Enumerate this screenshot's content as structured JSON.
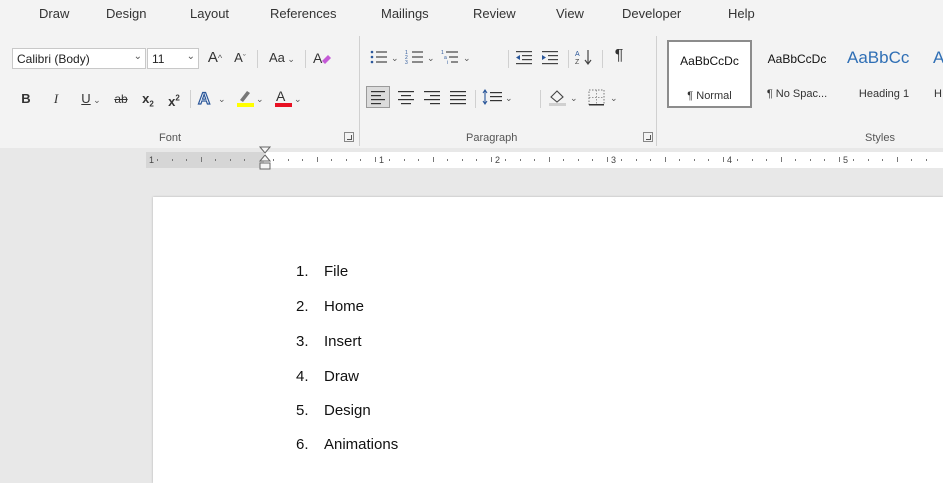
{
  "menu": {
    "items": [
      "Draw",
      "Design",
      "Layout",
      "References",
      "Mailings",
      "Review",
      "View",
      "Developer",
      "Help"
    ]
  },
  "font_group": {
    "font_name": "Calibri (Body)",
    "font_size": "11",
    "change_case_label": "Aa",
    "label": "Font"
  },
  "paragraph_group": {
    "label": "Paragraph"
  },
  "styles_group": {
    "label": "Styles",
    "items": [
      {
        "preview": "AaBbCcDc",
        "name": "¶ Normal"
      },
      {
        "preview": "AaBbCcDc",
        "name": "¶ No Spac..."
      },
      {
        "preview": "AaBbCc",
        "name": "Heading 1"
      },
      {
        "preview": "A",
        "name": "H"
      }
    ]
  },
  "ruler": {
    "numbers": [
      "1",
      "1",
      "2",
      "3",
      "4",
      "5"
    ]
  },
  "document": {
    "list": [
      {
        "num": "1.",
        "label": "File"
      },
      {
        "num": "2.",
        "label": "Home"
      },
      {
        "num": "3.",
        "label": "Insert"
      },
      {
        "num": "4.",
        "label": "Draw"
      },
      {
        "num": "5.",
        "label": "Design"
      },
      {
        "num": "6.",
        "label": "Animations"
      }
    ]
  },
  "colors": {
    "accent_blue": "#2b579a",
    "highlight_yellow": "#ffff00",
    "font_color_red": "#e81123"
  }
}
